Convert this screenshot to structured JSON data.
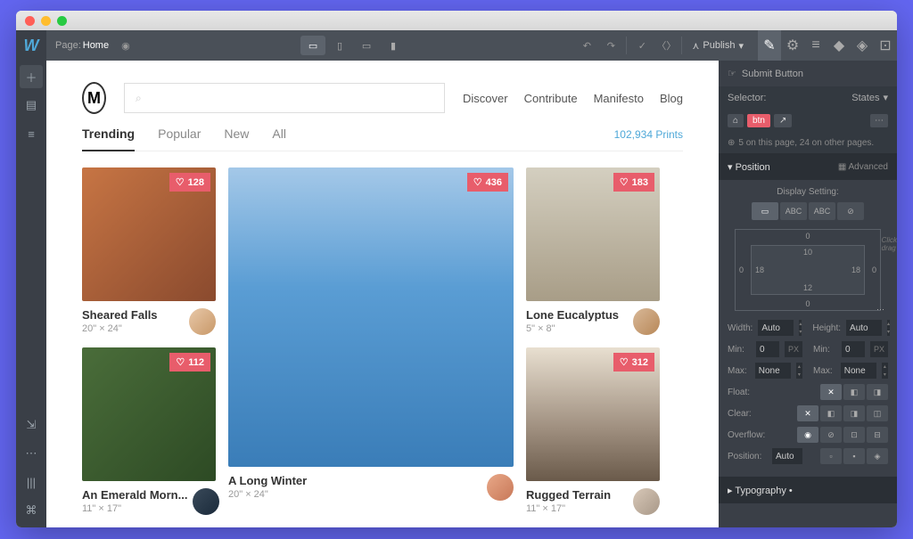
{
  "topbar": {
    "page_label": "Page:",
    "page_name": "Home",
    "publish_label": "Publish"
  },
  "canvas": {
    "logo_letter": "M",
    "nav": [
      "Discover",
      "Contribute",
      "Manifesto",
      "Blog"
    ],
    "tabs": [
      "Trending",
      "Popular",
      "New",
      "All"
    ],
    "prints_count": "102,934 Prints",
    "cards": [
      {
        "title": "Sheared Falls",
        "dims": "20\" × 24\"",
        "likes": "128"
      },
      {
        "title": "A Long Winter",
        "dims": "20\" × 24\"",
        "likes": "436"
      },
      {
        "title": "Lone Eucalyptus",
        "dims": "5\" × 8\"",
        "likes": "183"
      },
      {
        "title": "An Emerald Morn...",
        "dims": "11\" × 17\"",
        "likes": "112"
      },
      {
        "title": "Rugged Terrain",
        "dims": "11\" × 17\"",
        "likes": "312"
      }
    ]
  },
  "panel": {
    "crumb": "Submit Button",
    "selector_label": "Selector:",
    "states_label": "States",
    "tags": {
      "first": "⌂",
      "second": "btn",
      "third": "↗"
    },
    "usage": "5 on this page, 24 on other pages.",
    "position_label": "Position",
    "advanced_label": "Advanced",
    "display_label": "Display Setting:",
    "box": {
      "top_out": "0",
      "right_out": "0",
      "bottom_out": "0",
      "left_out": "0",
      "top_in": "10",
      "right_in": "18",
      "bottom_in": "12",
      "left_in": "18"
    },
    "width_label": "Width:",
    "width_val": "Auto",
    "height_label": "Height:",
    "height_val": "Auto",
    "min_label": "Min:",
    "min_val": "0",
    "min_unit": "PX",
    "max_label": "Max:",
    "max_val": "None",
    "float_label": "Float:",
    "clear_label": "Clear:",
    "overflow_label": "Overflow:",
    "position_prop_label": "Position:",
    "position_val": "Auto",
    "typography_label": "Typography"
  }
}
